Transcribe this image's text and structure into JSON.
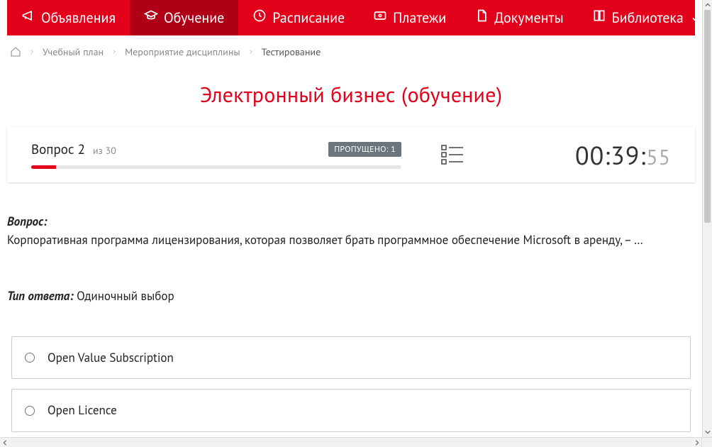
{
  "nav": {
    "items": [
      {
        "label": "Объявления"
      },
      {
        "label": "Обучение"
      },
      {
        "label": "Расписание"
      },
      {
        "label": "Платежи"
      },
      {
        "label": "Документы"
      },
      {
        "label": "Библиотека"
      }
    ]
  },
  "breadcrumb": {
    "items": [
      {
        "label": "Учебный план"
      },
      {
        "label": "Мероприятие дисциплины"
      },
      {
        "label": "Тестирование"
      }
    ]
  },
  "page": {
    "title": "Электронный бизнес (обучение)"
  },
  "status": {
    "question_word": "Вопрос",
    "question_number": "2",
    "of_word": "из",
    "total": "30",
    "skipped_label": "ПРОПУЩЕНО: 1",
    "timer_main": "00:39:",
    "timer_secs": "55"
  },
  "question": {
    "label": "Вопрос:",
    "text": "Корпоративная программа лицензирования, которая позволяет брать программное обеспечение Microsoft в аренду, – …",
    "answer_type_label": "Тип ответа:",
    "answer_type_value": "Одиночный выбор"
  },
  "options": [
    {
      "label": "Open Value Subscription"
    },
    {
      "label": "Open Licence"
    }
  ]
}
